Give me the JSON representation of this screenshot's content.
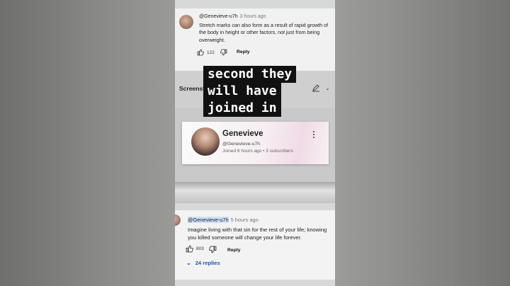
{
  "top_comment": {
    "handle": "@Genevieve-u7h",
    "time": "3 hours ago",
    "text": "Stretch marks can also form as a result of rapid growth of the body in height or other factors, not just from being overweight.",
    "likes": "122",
    "reply_label": "Reply"
  },
  "screenshot_bar": {
    "label": "Screenshot"
  },
  "caption": {
    "lines": [
      "second they",
      "will have",
      "joined in"
    ]
  },
  "profile": {
    "name": "Genevieve",
    "handle": "@Genevieve-u7h",
    "meta": "Joined 6 hours ago • 3 subscribers"
  },
  "bottom_comment": {
    "handle": "@Genevieve-u7h",
    "time": "5 hours ago",
    "text": "Imagine living with that sin for the rest of your life; knowing you killed someone will change your life forever.",
    "likes": "803",
    "reply_label": "Reply",
    "replies_label": "24 replies"
  },
  "colors": {
    "link_blue": "#1a56b8",
    "caption_bg": "#111111",
    "caption_text": "#ffffff"
  }
}
